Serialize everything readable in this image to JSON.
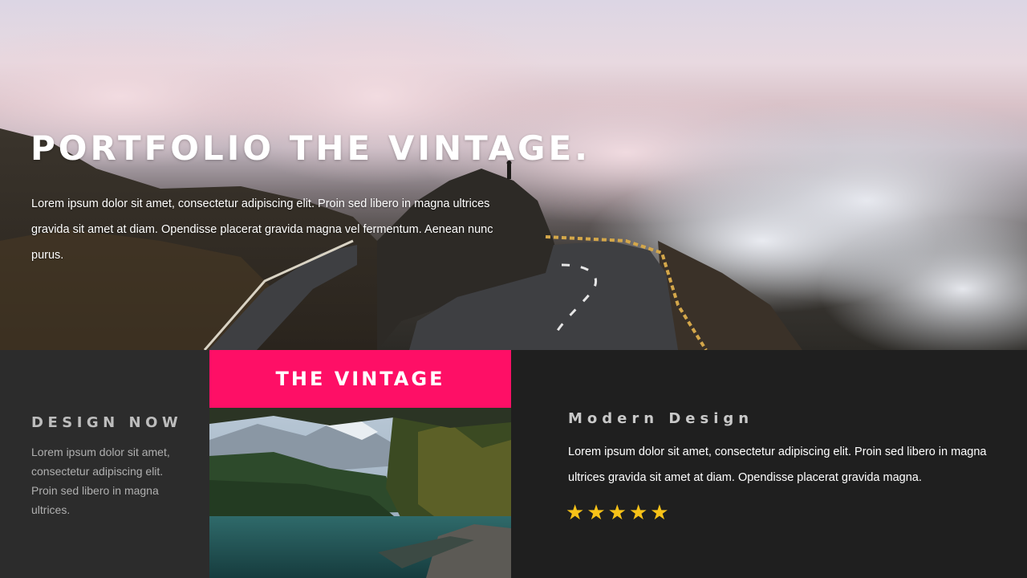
{
  "hero": {
    "title": "PORTFOLIO THE VINTAGE.",
    "text": "Lorem ipsum dolor sit amet, consectetur adipiscing elit. Proin sed libero in magna ultrices gravida sit amet at diam. Opendisse placerat gravida magna vel fermentum. Aenean nunc purus."
  },
  "left": {
    "heading": "DESIGN NOW",
    "text": "Lorem ipsum dolor sit amet, consectetur adipiscing elit. Proin sed libero in magna ultrices."
  },
  "center": {
    "banner": "THE VINTAGE",
    "accent_color": "#fe0f66"
  },
  "right": {
    "heading": "Modern Design",
    "text": "Lorem ipsum dolor sit amet, consectetur adipiscing elit. Proin sed libero in magna ultrices gravida sit amet at diam. Opendisse placerat gravida magna.",
    "rating": {
      "value": 5,
      "max": 5,
      "color": "#f7c218"
    }
  }
}
